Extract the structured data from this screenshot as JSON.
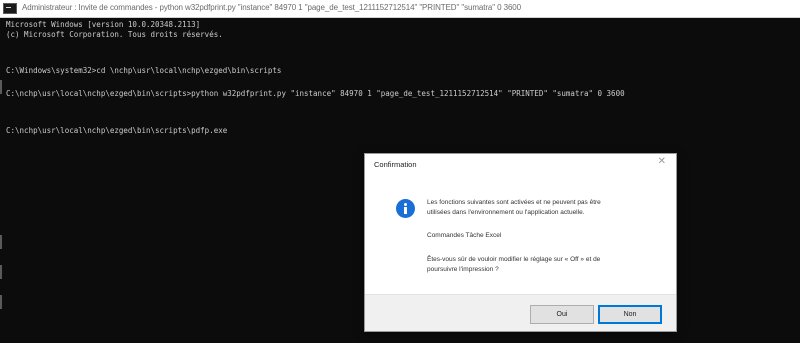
{
  "window": {
    "title": "Administrateur : Invite de commandes - python w32pdfprint.py \"instance\" 84970 1 \"page_de_test_1211152712514\" \"PRINTED\" \"sumatra\" 0 3600"
  },
  "console": {
    "lines": [
      "Microsoft Windows [version 10.0.20348.2113]",
      "(c) Microsoft Corporation. Tous droits réservés.",
      "C:\\Windows\\system32>cd \\nchp\\usr\\local\\nchp\\ezged\\bin\\scripts",
      "C:\\nchp\\usr\\local\\nchp\\ezged\\bin\\scripts>python w32pdfprint.py \"instance\" 84970 1 \"page_de_test_1211152712514\" \"PRINTED\" \"sumatra\" 0 3600",
      "C:\\nchp\\usr\\local\\nchp\\ezged\\bin\\scripts\\pdfp.exe"
    ]
  },
  "dialog": {
    "title": "Confirmation",
    "close": "✕",
    "icon": "info-icon",
    "message_line1": "Les fonctions suivantes sont activées et ne peuvent pas être",
    "message_line2": "utilisées dans l'environnement ou l'application actuelle.",
    "feature": "Commandes Tâche Excel",
    "question_line1": "Êtes-vous sûr de vouloir modifier le réglage sur « Off » et de",
    "question_line2": "poursuivre l'impression ?",
    "yes_label": "Oui",
    "no_label": "Non"
  }
}
